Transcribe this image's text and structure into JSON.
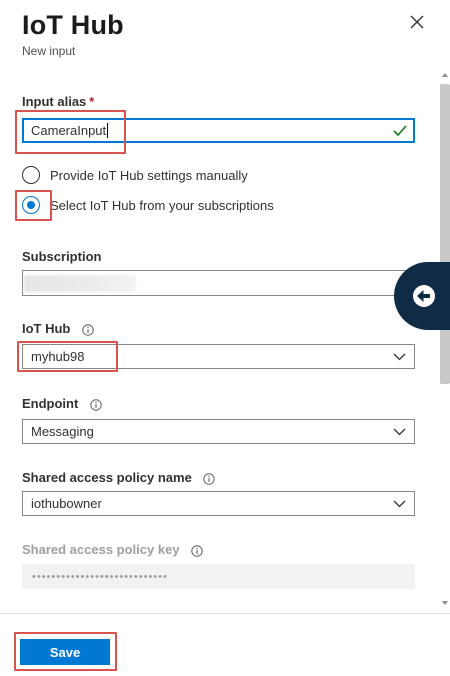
{
  "header": {
    "title": "IoT Hub",
    "subtitle": "New input",
    "close_icon": "close-icon"
  },
  "form": {
    "input_alias": {
      "label": "Input alias",
      "required_mark": "*",
      "value": "CameraInput",
      "valid_icon": "checkmark-icon"
    },
    "source_options": [
      {
        "label": "Provide IoT Hub settings manually",
        "selected": false
      },
      {
        "label": "Select IoT Hub from your subscriptions",
        "selected": true
      }
    ],
    "subscription": {
      "label": "Subscription",
      "value": ""
    },
    "iot_hub": {
      "label": "IoT Hub",
      "value": "myhub98"
    },
    "endpoint": {
      "label": "Endpoint",
      "value": "Messaging"
    },
    "shared_access_policy_name": {
      "label": "Shared access policy name",
      "value": "iothubowner"
    },
    "shared_access_policy_key": {
      "label": "Shared access policy key",
      "value": "••••••••••••••••••••••••••••"
    }
  },
  "footer": {
    "save_label": "Save"
  },
  "colors": {
    "accent": "#0078d4",
    "highlight": "#d9534f",
    "valid": "#107c10",
    "collapse_button": "#0f2b46"
  }
}
